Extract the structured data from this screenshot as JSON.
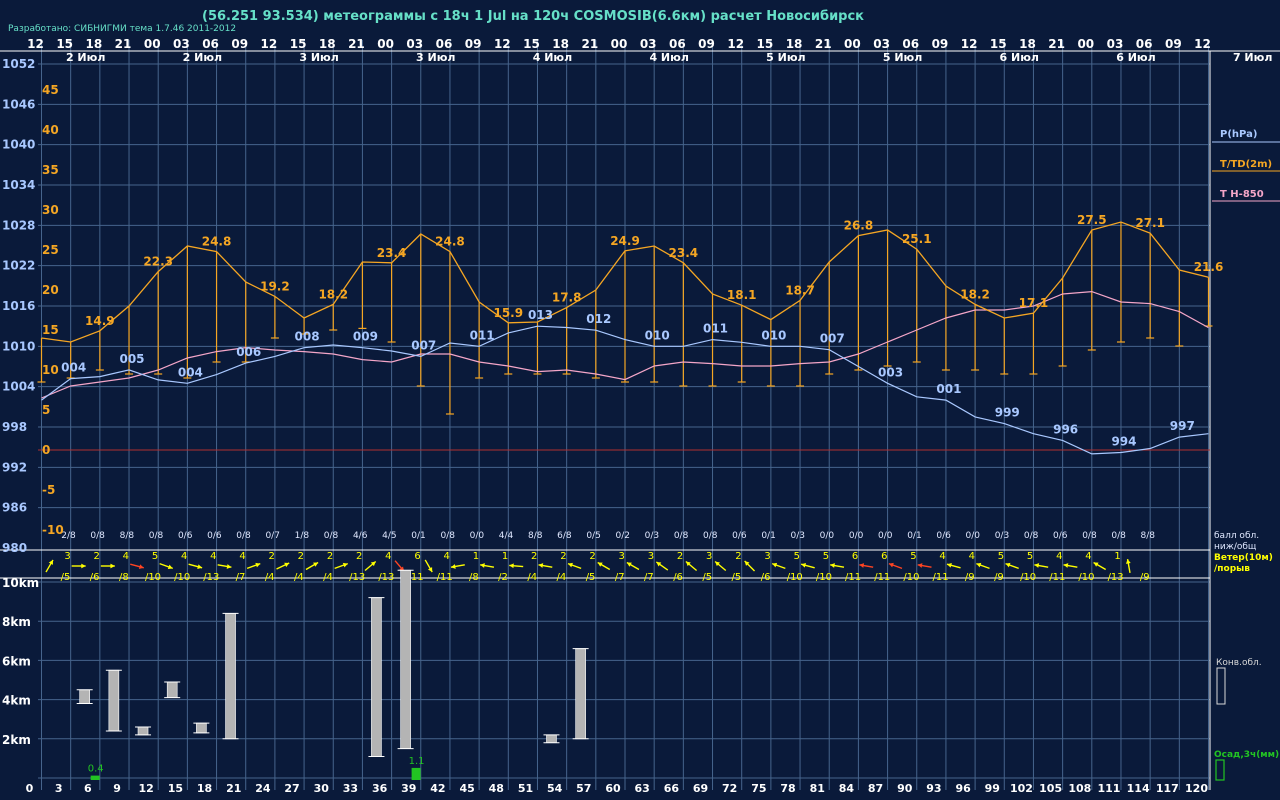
{
  "header": {
    "title": "(56.251 93.534) метеограммы с  18ч 1 Jul на 120ч COSMOSIB(6.6км) расчет Новосибирск",
    "developer": "Разработано: СИБНИГМИ тема 1.7.46 2011-2012"
  },
  "colors": {
    "background": "#0a1a3a",
    "grid": "#46648c",
    "pressure": "#a9c8ff",
    "temperature": "#f5a623",
    "t850": "#f4a6c8",
    "zero_line": "#b03030",
    "cloud_bar": "#b4b4b4",
    "precip": "#22c422",
    "wind": "#ffff00",
    "wind_strong": "#ff4422"
  },
  "chart_data": {
    "type": "line",
    "hours": [
      "12",
      "15",
      "18",
      "21",
      "00",
      "03",
      "06",
      "09",
      "12",
      "15",
      "18",
      "21",
      "00",
      "03",
      "06",
      "09",
      "12",
      "15",
      "18",
      "21",
      "00",
      "03",
      "06",
      "09",
      "12",
      "15",
      "18",
      "21",
      "00",
      "03",
      "06",
      "09",
      "12",
      "15",
      "18",
      "21",
      "00",
      "03",
      "06",
      "09",
      "12"
    ],
    "days": [
      {
        "label": "2 Июл",
        "col": 1
      },
      {
        "label": "2 Июл",
        "col": 5
      },
      {
        "label": "3 Июл",
        "col": 9
      },
      {
        "label": "3 Июл",
        "col": 13
      },
      {
        "label": "4 Июл",
        "col": 17
      },
      {
        "label": "4 Июл",
        "col": 21
      },
      {
        "label": "5 Июл",
        "col": 25
      },
      {
        "label": "5 Июл",
        "col": 29
      },
      {
        "label": "6 Июл",
        "col": 33
      },
      {
        "label": "6 Июл",
        "col": 37
      },
      {
        "label": "7 Июл",
        "col": 41
      }
    ],
    "pressure_ticks": [
      "1052",
      "1046",
      "1040",
      "1034",
      "1028",
      "1022",
      "1016",
      "1010",
      "1004",
      "998",
      "992",
      "986",
      "980"
    ],
    "temp_ticks": [
      "45",
      "40",
      "35",
      "30",
      "25",
      "20",
      "15",
      "10",
      "5",
      "0",
      "-5",
      "-10"
    ],
    "lead_times": [
      0,
      3,
      6,
      9,
      12,
      15,
      18,
      21,
      24,
      27,
      30,
      33,
      36,
      39,
      42,
      45,
      48,
      51,
      54,
      57,
      60,
      63,
      66,
      69,
      72,
      75,
      78,
      81,
      84,
      87,
      90,
      93,
      96,
      99,
      102,
      105,
      108,
      111,
      114,
      117,
      120
    ],
    "lead_labels": [
      "0",
      "3",
      "6",
      "9",
      "12",
      "15",
      "18",
      "21",
      "24",
      "27",
      "30",
      "33",
      "36",
      "39",
      "42",
      "45",
      "48",
      "51",
      "54",
      "57",
      "60",
      "63",
      "66",
      "69",
      "72",
      "75",
      "78",
      "81",
      "84",
      "87",
      "90",
      "93",
      "96",
      "99",
      "102",
      "105",
      "108",
      "111",
      "114",
      "117",
      "120"
    ],
    "series": [
      {
        "name": "P(hPa)",
        "values": [
          1002.0,
          1005.2,
          1005.5,
          1006.5,
          1005.0,
          1004.5,
          1005.8,
          1007.5,
          1008.5,
          1009.8,
          1010.2,
          1009.8,
          1009.3,
          1008.5,
          1010.5,
          1010.0,
          1012.0,
          1013.0,
          1012.8,
          1012.4,
          1011.0,
          1010.0,
          1010.0,
          1011.0,
          1010.6,
          1010.0,
          1010.0,
          1009.5,
          1007.0,
          1004.5,
          1002.5,
          1002.0,
          999.5,
          998.5,
          997.0,
          996.0,
          994.0,
          994.2,
          994.8,
          996.5,
          997.0
        ]
      },
      {
        "name": "T H-850",
        "values": [
          6.5,
          8.0,
          8.5,
          9.0,
          10.0,
          11.5,
          12.3,
          12.8,
          12.5,
          12.3,
          12.0,
          11.3,
          11.0,
          12.0,
          12.0,
          11.0,
          10.5,
          9.8,
          10.0,
          9.5,
          8.8,
          10.5,
          11.0,
          10.8,
          10.5,
          10.5,
          10.8,
          11.0,
          12.0,
          13.5,
          15.0,
          16.5,
          17.5,
          17.5,
          18.0,
          19.5,
          19.8,
          18.5,
          18.3,
          17.3,
          15.3
        ]
      },
      {
        "name": "T/TD(2m)",
        "values": [
          14.0,
          13.5,
          14.9,
          18.0,
          22.3,
          25.5,
          24.8,
          21.0,
          19.2,
          16.5,
          18.2,
          23.5,
          23.4,
          27.0,
          24.8,
          18.5,
          15.9,
          16.0,
          17.8,
          20.0,
          24.9,
          25.5,
          23.4,
          19.5,
          18.1,
          16.3,
          18.7,
          23.5,
          26.8,
          27.5,
          25.1,
          20.5,
          18.2,
          16.5,
          17.1,
          21.5,
          27.5,
          28.5,
          27.1,
          22.5,
          21.6
        ]
      }
    ],
    "dew_points": [
      8.5,
      9.0,
      10.0,
      9.5,
      9.5,
      9.0,
      11.0,
      11.0,
      14.0,
      14.5,
      15.0,
      15.2,
      13.5,
      8.0,
      4.5,
      9.0,
      9.5,
      9.5,
      9.5,
      9.0,
      8.5,
      8.5,
      8.0,
      8.0,
      8.5,
      8.0,
      8.0,
      9.5,
      10.0,
      10.5,
      11.0,
      10.0,
      10.0,
      9.5,
      9.5,
      10.5,
      12.5,
      13.5,
      14.0,
      13.0,
      15.5
    ],
    "temp_labels": [
      {
        "i": 2,
        "text": "14.9"
      },
      {
        "i": 4,
        "text": "22.3"
      },
      {
        "i": 6,
        "text": "24.8"
      },
      {
        "i": 8,
        "text": "19.2"
      },
      {
        "i": 10,
        "text": "18.2"
      },
      {
        "i": 12,
        "text": "23.4"
      },
      {
        "i": 14,
        "text": "24.8"
      },
      {
        "i": 16,
        "text": "15.9"
      },
      {
        "i": 18,
        "text": "17.8"
      },
      {
        "i": 20,
        "text": "24.9"
      },
      {
        "i": 22,
        "text": "23.4"
      },
      {
        "i": 24,
        "text": "18.1"
      },
      {
        "i": 26,
        "text": "18.7"
      },
      {
        "i": 28,
        "text": "26.8"
      },
      {
        "i": 30,
        "text": "25.1"
      },
      {
        "i": 32,
        "text": "18.2"
      },
      {
        "i": 34,
        "text": "17.1"
      },
      {
        "i": 36,
        "text": "27.5"
      },
      {
        "i": 38,
        "text": "27.1"
      },
      {
        "i": 40,
        "text": "21.6"
      }
    ],
    "pressure_labels": [
      {
        "i": 1,
        "text": "004"
      },
      {
        "i": 3,
        "text": "005"
      },
      {
        "i": 5,
        "text": "004"
      },
      {
        "i": 7,
        "text": "006"
      },
      {
        "i": 9,
        "text": "008"
      },
      {
        "i": 11,
        "text": "009"
      },
      {
        "i": 13,
        "text": "007"
      },
      {
        "i": 15,
        "text": "011"
      },
      {
        "i": 17,
        "text": "013"
      },
      {
        "i": 19,
        "text": "012"
      },
      {
        "i": 21,
        "text": "010"
      },
      {
        "i": 23,
        "text": "011"
      },
      {
        "i": 25,
        "text": "010"
      },
      {
        "i": 27,
        "text": "007"
      },
      {
        "i": 29,
        "text": "003"
      },
      {
        "i": 31,
        "text": "001"
      },
      {
        "i": 33,
        "text": "999"
      },
      {
        "i": 35,
        "text": "996"
      },
      {
        "i": 37,
        "text": "994"
      },
      {
        "i": 39,
        "text": "997"
      }
    ],
    "clouds": [
      "2/8",
      "0/8",
      "8/8",
      "0/8",
      "0/6",
      "0/6",
      "0/8",
      "0/7",
      "1/8",
      "0/8",
      "4/6",
      "4/5",
      "0/1",
      "0/8",
      "0/0",
      "4/4",
      "8/8",
      "6/8",
      "0/5",
      "0/2",
      "0/3",
      "0/8",
      "0/8",
      "0/6",
      "0/1",
      "0/3",
      "0/0",
      "0/0",
      "0/0",
      "0/1",
      "0/6",
      "0/0",
      "0/3",
      "0/8",
      "0/6",
      "0/8",
      "0/8",
      "8/8"
    ],
    "wind_speed": [
      "3",
      "2",
      "4",
      "5",
      "4",
      "4",
      "4",
      "2",
      "2",
      "2",
      "2",
      "4",
      "6",
      "4",
      "1",
      "1",
      "2",
      "2",
      "2",
      "3",
      "3",
      "2",
      "3",
      "2",
      "3",
      "5",
      "5",
      "6",
      "6",
      "5",
      "4",
      "4",
      "5",
      "5",
      "4",
      "4",
      "1"
    ],
    "wind_gust": [
      "/5",
      "/6",
      "/8",
      "/10",
      "/10",
      "/13",
      "/7",
      "/4",
      "/4",
      "/4",
      "/13",
      "/13",
      "/11",
      "/11",
      "/8",
      "/2",
      "/4",
      "/4",
      "/5",
      "/7",
      "/7",
      "/6",
      "/5",
      "/5",
      "/6",
      "/10",
      "/10",
      "/11",
      "/11",
      "/10",
      "/11",
      "/9",
      "/9",
      "/10",
      "/11",
      "/10",
      "/13",
      "/9"
    ],
    "wind_strong_idx": [
      3,
      12,
      28,
      29,
      30
    ],
    "cloud_bars": [
      {
        "i": 1,
        "bottom": 3.8,
        "top": 4.5
      },
      {
        "i": 2,
        "bottom": 2.4,
        "top": 5.5
      },
      {
        "i": 3,
        "bottom": 2.2,
        "top": 2.6
      },
      {
        "i": 4,
        "bottom": 4.1,
        "top": 4.9
      },
      {
        "i": 5,
        "bottom": 2.3,
        "top": 2.8
      },
      {
        "i": 6,
        "bottom": 2.0,
        "top": 8.4
      },
      {
        "i": 11,
        "bottom": 1.1,
        "top": 9.2
      },
      {
        "i": 12,
        "bottom": 1.5,
        "top": 10.6
      },
      {
        "i": 17,
        "bottom": 1.8,
        "top": 2.2
      },
      {
        "i": 18,
        "bottom": 2.0,
        "top": 6.6
      }
    ],
    "precip": [
      {
        "i": 1,
        "value": 0.4,
        "label": "0.4"
      },
      {
        "i": 12,
        "value": 1.1,
        "label": "1.1"
      }
    ],
    "height_ticks": [
      {
        "km": 10,
        "label": "10km"
      },
      {
        "km": 8,
        "label": "8km"
      },
      {
        "km": 6,
        "label": "6km"
      },
      {
        "km": 4,
        "label": "4km"
      },
      {
        "km": 2,
        "label": "2km"
      }
    ],
    "legend": {
      "pressure": "P(hPa)",
      "temperature": "T/TD(2m)",
      "t850": "T H-850",
      "cloud_cover_1": "балл обл.",
      "cloud_cover_2": "ниж/общ",
      "wind_1": "Ветер(10м)",
      "wind_2": "/порыв",
      "convective": "Конв.обл.",
      "precip": "Осад,3ч(мм)"
    },
    "pressure_range": [
      980,
      1052
    ],
    "temp_range": [
      -10,
      45
    ],
    "height_range": [
      0,
      10.8
    ],
    "grid": true
  }
}
